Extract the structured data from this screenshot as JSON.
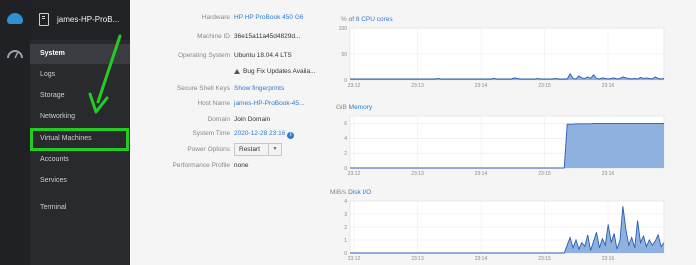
{
  "host": {
    "name": "james-HP-ProB..."
  },
  "sidebar": {
    "items": [
      {
        "label": "System",
        "active": true
      },
      {
        "label": "Logs"
      },
      {
        "label": "Storage"
      },
      {
        "label": "Networking"
      },
      {
        "label": "Virtual Machines",
        "highlighted": true
      },
      {
        "label": "Accounts"
      },
      {
        "label": "Services"
      },
      {
        "label": "Terminal"
      }
    ]
  },
  "system_info": {
    "hardware": {
      "label": "Hardware",
      "value": "HP HP ProBook 450 G6"
    },
    "machine_id": {
      "label": "Machine ID",
      "value": "36e15a11a45d4829d..."
    },
    "os": {
      "label": "Operating System",
      "value": "Ubuntu 18.04.4 LTS"
    },
    "updates": {
      "value": "Bug Fix Updates Availa..."
    },
    "ssh_keys": {
      "label": "Secure Shell Keys",
      "value": "Show fingerprints"
    },
    "host_name": {
      "label": "Host Name",
      "value": "james-HP-ProBook-45..."
    },
    "domain": {
      "label": "Domain",
      "value": "Join Domain"
    },
    "system_time": {
      "label": "System Time",
      "value": "2020-12-28 23:16"
    },
    "power": {
      "label": "Power Options",
      "value": "Restart"
    },
    "profile": {
      "label": "Performance Profile",
      "value": "none"
    }
  },
  "colors": {
    "accent": "#2e7bcf",
    "highlight": "#22cc22",
    "series_fill": "#8fb1e0",
    "series_line": "#2a5db0"
  },
  "chart_data": [
    {
      "type": "area",
      "unit": "%",
      "title": "of 8 CPU cores",
      "x": [
        "23:12",
        "23:13",
        "23:14",
        "23:15",
        "23:16"
      ],
      "y_ticks": [
        "100",
        "50",
        "0"
      ],
      "ylim": [
        0,
        100
      ],
      "series": [
        {
          "values": [
            2,
            2,
            2,
            2,
            2,
            2,
            2,
            2,
            2,
            2,
            2,
            2,
            2,
            2,
            2,
            2,
            2,
            2,
            2,
            2,
            2,
            2,
            2,
            2,
            2,
            2,
            2,
            2,
            2,
            2,
            3,
            2,
            2,
            2,
            2,
            2,
            2,
            2,
            2,
            2,
            2,
            2,
            2,
            2,
            2,
            2,
            2,
            2,
            2,
            3,
            2,
            2,
            2,
            2,
            2,
            2,
            4,
            3,
            2,
            2,
            2,
            2,
            2,
            2,
            3,
            2,
            2,
            2,
            2,
            2,
            3,
            2,
            2,
            2,
            2,
            12,
            3,
            2,
            8,
            4,
            3,
            6,
            3,
            10,
            3,
            2,
            4,
            3,
            2,
            3,
            4,
            2,
            3,
            6,
            4,
            3,
            2,
            3,
            2,
            5,
            3,
            4,
            3,
            2,
            6,
            3,
            2,
            3
          ]
        }
      ]
    },
    {
      "type": "area",
      "unit": "GiB",
      "title": "Memory",
      "x": [
        "23:12",
        "23:13",
        "23:14",
        "23:15",
        "23:16"
      ],
      "y_ticks": [
        "6",
        "4",
        "2",
        "0"
      ],
      "ylim": [
        0,
        7
      ],
      "series": [
        {
          "values": [
            0,
            0,
            0,
            0,
            0,
            0,
            0,
            0,
            0,
            0,
            0,
            0,
            0,
            0,
            0,
            0,
            0,
            0,
            0,
            0,
            0,
            0,
            0,
            0,
            0,
            0,
            0,
            0,
            0,
            0,
            0,
            0,
            0,
            0,
            0,
            0,
            0,
            0,
            0,
            0,
            0,
            0,
            0,
            0,
            0,
            0,
            0,
            0,
            0,
            0,
            0,
            0,
            0,
            0,
            0,
            0,
            0,
            0,
            0,
            0,
            0,
            0,
            0,
            0,
            0,
            0,
            0,
            0,
            0,
            0,
            0,
            0,
            0,
            0,
            5.9,
            5.9,
            5.9,
            5.95,
            5.95,
            5.95,
            5.95,
            5.95,
            5.95,
            6,
            6,
            6,
            6,
            6,
            6,
            6,
            6,
            6,
            6,
            6,
            6,
            6,
            6,
            6,
            6,
            6,
            6,
            6,
            6,
            6,
            6,
            6,
            6,
            6
          ]
        }
      ]
    },
    {
      "type": "area",
      "unit": "MiB/s",
      "title": "Disk I/O",
      "x": [
        "23:12",
        "23:13",
        "23:14",
        "23:15",
        "23:16"
      ],
      "y_ticks": [
        "4",
        "3",
        "2",
        "1",
        "0"
      ],
      "ylim": [
        0,
        4
      ],
      "series": [
        {
          "values": [
            0,
            0,
            0,
            0,
            0,
            0,
            0,
            0,
            0,
            0,
            0,
            0,
            0,
            0,
            0,
            0,
            0,
            0,
            0,
            0,
            0,
            0,
            0,
            0,
            0,
            0,
            0,
            0,
            0,
            0,
            0,
            0,
            0,
            0,
            0,
            0,
            0,
            0,
            0,
            0,
            0,
            0,
            0,
            0,
            0,
            0,
            0,
            0,
            0,
            0,
            0,
            0,
            0,
            0,
            0,
            0,
            0,
            0,
            0,
            0,
            0,
            0,
            0,
            0,
            0,
            0,
            0,
            0,
            0,
            0,
            0,
            0,
            0,
            0,
            0.6,
            1.2,
            0.4,
            1.0,
            0.3,
            0.8,
            0.5,
            1.4,
            0.2,
            0.9,
            1.6,
            0.4,
            1.1,
            0.6,
            2.2,
            0.8,
            1.5,
            0.3,
            1.0,
            3.6,
            1.8,
            0.6,
            1.2,
            0.4,
            2.5,
            0.8,
            1.3,
            0.5,
            1.0,
            0.6,
            0.9,
            1.4,
            0.5,
            0.8
          ]
        }
      ]
    }
  ]
}
